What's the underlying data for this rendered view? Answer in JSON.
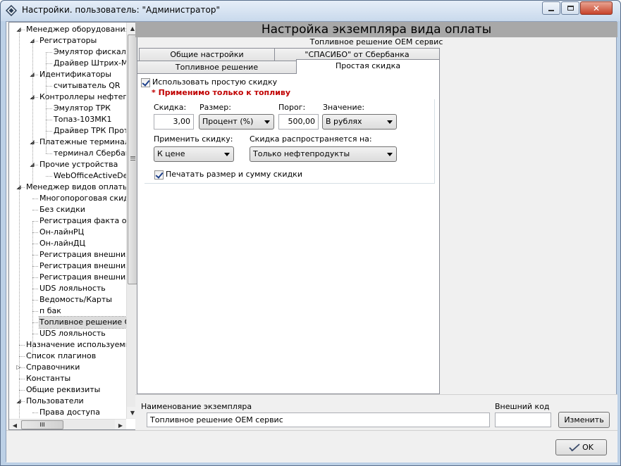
{
  "window": {
    "title": "Настройки. пользователь: \"Администратор\"",
    "icon": "app-diamond-icon"
  },
  "tree": {
    "nodes": [
      {
        "label": "Менеджер оборудования",
        "level": 0,
        "expander": "expanded"
      },
      {
        "label": "Регистраторы",
        "level": 1,
        "expander": "expanded"
      },
      {
        "label": "Эмулятор фискаль",
        "level": 2,
        "expander": "none"
      },
      {
        "label": "Драйвер Штрих-М",
        "level": 2,
        "expander": "none"
      },
      {
        "label": "Идентификаторы",
        "level": 1,
        "expander": "expanded"
      },
      {
        "label": "считыватель QR",
        "level": 2,
        "expander": "none"
      },
      {
        "label": "Контроллеры нефтепр",
        "level": 1,
        "expander": "expanded"
      },
      {
        "label": "Эмулятор ТРК",
        "level": 2,
        "expander": "none"
      },
      {
        "label": "Топаз-103МК1",
        "level": 2,
        "expander": "none"
      },
      {
        "label": "Драйвер ТРК Прот",
        "level": 2,
        "expander": "none"
      },
      {
        "label": "Платежные терминалы",
        "level": 1,
        "expander": "expanded"
      },
      {
        "label": "терминал Сбербанк",
        "level": 2,
        "expander": "none"
      },
      {
        "label": "Прочие устройства",
        "level": 1,
        "expander": "expanded"
      },
      {
        "label": "WebOfficeActiveDe",
        "level": 2,
        "expander": "none"
      },
      {
        "label": "Менеджер видов оплаты",
        "level": 0,
        "expander": "expanded"
      },
      {
        "label": "Многопороговая скидк",
        "level": 1,
        "expander": "none"
      },
      {
        "label": "Без скидки",
        "level": 1,
        "expander": "none"
      },
      {
        "label": "Регистрация факта от",
        "level": 1,
        "expander": "none"
      },
      {
        "label": "Он-лайнРЦ",
        "level": 1,
        "expander": "none"
      },
      {
        "label": "Он-лайнДЦ",
        "level": 1,
        "expander": "none"
      },
      {
        "label": "Регистрация внешних",
        "level": 1,
        "expander": "none"
      },
      {
        "label": "Регистрация внешних",
        "level": 1,
        "expander": "none"
      },
      {
        "label": "Регистрация внешних",
        "level": 1,
        "expander": "none"
      },
      {
        "label": "UDS лояльность",
        "level": 1,
        "expander": "none"
      },
      {
        "label": "Ведомость/Карты",
        "level": 1,
        "expander": "none"
      },
      {
        "label": "п бак",
        "level": 1,
        "expander": "none"
      },
      {
        "label": "Топливное решение ОІ",
        "level": 1,
        "expander": "none",
        "selected": true
      },
      {
        "label": "UDS лояльность",
        "level": 1,
        "expander": "none"
      },
      {
        "label": "Назначение используемых",
        "level": 0,
        "expander": "none"
      },
      {
        "label": "Список плагинов",
        "level": 0,
        "expander": "none"
      },
      {
        "label": "Справочники",
        "level": 0,
        "expander": "collapsed"
      },
      {
        "label": "Константы",
        "level": 0,
        "expander": "none"
      },
      {
        "label": "Общие реквизиты",
        "level": 0,
        "expander": "none"
      },
      {
        "label": "Пользователи",
        "level": 0,
        "expander": "expanded"
      },
      {
        "label": "Права доступа",
        "level": 1,
        "expander": "none"
      }
    ],
    "hscroll_grip": "III"
  },
  "main": {
    "header": "Настройка экземпляра вида оплаты",
    "subheader": "Топливное решение ОЕМ сервис",
    "tabs": {
      "row1": [
        "Общие настройки",
        "\"СПАСИБО\" от Сбербанка"
      ],
      "row2": [
        "Топливное решение",
        "Простая скидка"
      ],
      "active": "Простая скидка"
    },
    "simple_discount": {
      "use_checkbox_label": "Использовать простую скидку",
      "use_checked": true,
      "warning": "* Применимо только к топливу",
      "discount_label": "Скидка:",
      "discount_value": "3,00",
      "size_label": "Размер:",
      "size_value": "Процент (%)",
      "threshold_label": "Порог:",
      "threshold_value": "500,00",
      "value_label": "Значение:",
      "value_value": "В рублях",
      "apply_label": "Применить скидку:",
      "apply_value": "К цене",
      "extends_label": "Скидка распространяется на:",
      "extends_value": "Только нефтепродукты",
      "print_checkbox_label": "Печатать размер и сумму скидки",
      "print_checked": true
    }
  },
  "bottom": {
    "instance_name_label": "Наименование экземпляра",
    "instance_name_value": "Топливное решение ОЕМ сервис",
    "external_code_label": "Внешний код",
    "external_code_value": "",
    "change_button": "Изменить"
  },
  "footer": {
    "ok_button": "OK"
  }
}
